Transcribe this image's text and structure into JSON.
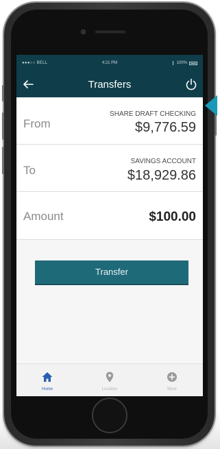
{
  "status_bar": {
    "carrier": "●●●○○ BELL",
    "time": "4:21 PM",
    "battery": "100%"
  },
  "header": {
    "title": "Transfers"
  },
  "transfer": {
    "from_label": "From",
    "from_account_name": "SHARE DRAFT CHECKING",
    "from_account_balance": "$9,776.59",
    "to_label": "To",
    "to_account_name": "SAVINGS ACCOUNT",
    "to_account_balance": "$18,929.86",
    "amount_label": "Amount",
    "amount_value": "$100.00",
    "button_label": "Transfer"
  },
  "tab_bar": {
    "tabs": [
      {
        "label": "Home",
        "icon": "home-icon",
        "active": true
      },
      {
        "label": "Location",
        "icon": "location-pin-icon",
        "active": false
      },
      {
        "label": "More",
        "icon": "more-icon",
        "active": false
      }
    ]
  },
  "colors": {
    "header_bg": "#0f3e4a",
    "button_bg": "#1f6a78",
    "accent_arrow": "#1a9ab8",
    "tab_active": "#2a5fb0",
    "tab_inactive": "#b5b5b5"
  }
}
